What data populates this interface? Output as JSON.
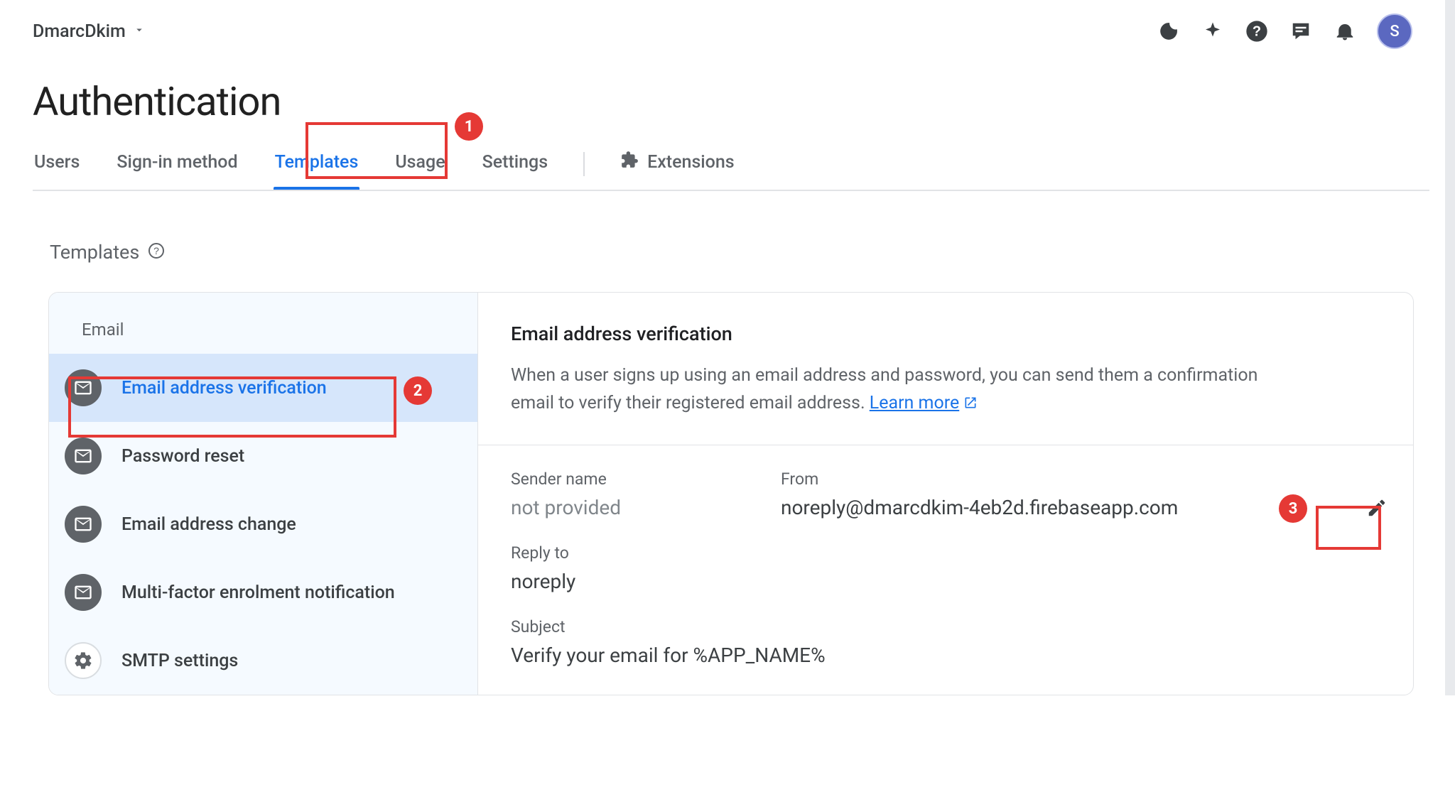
{
  "header": {
    "project_name": "DmarcDkim",
    "avatar_letter": "S"
  },
  "page_title": "Authentication",
  "tabs": [
    {
      "id": "users",
      "label": "Users"
    },
    {
      "id": "signin",
      "label": "Sign-in method"
    },
    {
      "id": "templates",
      "label": "Templates"
    },
    {
      "id": "usage",
      "label": "Usage"
    },
    {
      "id": "settings",
      "label": "Settings"
    },
    {
      "id": "extensions",
      "label": "Extensions"
    }
  ],
  "active_tab": "templates",
  "section": {
    "title": "Templates"
  },
  "sidebar": {
    "category": "Email",
    "items": [
      {
        "id": "verify",
        "label": "Email address verification",
        "icon": "mail",
        "selected": true
      },
      {
        "id": "pwreset",
        "label": "Password reset",
        "icon": "mail",
        "selected": false
      },
      {
        "id": "emailchange",
        "label": "Email address change",
        "icon": "mail",
        "selected": false
      },
      {
        "id": "mfa",
        "label": "Multi-factor enrolment notification",
        "icon": "mail",
        "selected": false
      },
      {
        "id": "smtp",
        "label": "SMTP settings",
        "icon": "gear",
        "selected": false
      }
    ]
  },
  "detail": {
    "title": "Email address verification",
    "description_prefix": "When a user signs up using an email address and password, you can send them a confirmation email to verify their registered email address. ",
    "learn_more": "Learn more",
    "fields": {
      "sender_name_label": "Sender name",
      "sender_name_value": "not provided",
      "from_label": "From",
      "from_value": "noreply@dmarcdkim-4eb2d.firebaseapp.com",
      "reply_to_label": "Reply to",
      "reply_to_value": "noreply",
      "subject_label": "Subject",
      "subject_value": "Verify your email for %APP_NAME%"
    }
  },
  "callouts": {
    "c1": "1",
    "c2": "2",
    "c3": "3"
  }
}
